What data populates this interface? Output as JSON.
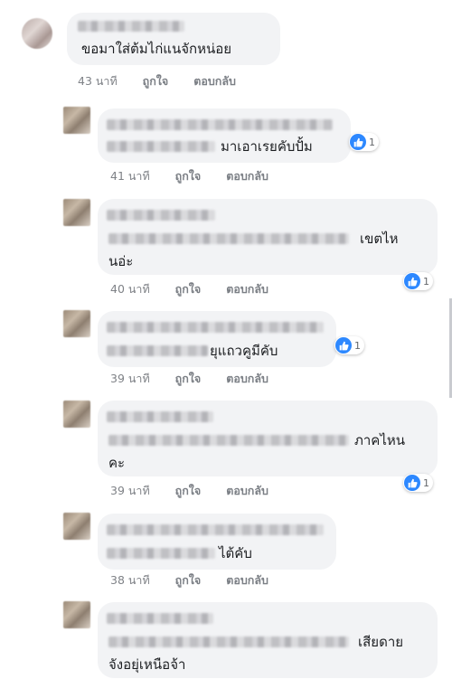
{
  "comments": [
    {
      "text": "ขอมาใส่ต้มไก่แนจักหน่อย",
      "time": "43 นาที",
      "like": "ถูกใจ",
      "reply": "ตอบกลับ"
    },
    {
      "text": "มาเอาเรยคับปั้ม",
      "time": "41 นาที",
      "like": "ถูกใจ",
      "reply": "ตอบกลับ",
      "reactions": "1"
    },
    {
      "text": "เขตไห",
      "text2": "นอ่ะ",
      "time": "40 นาที",
      "like": "ถูกใจ",
      "reply": "ตอบกลับ",
      "reactions": "1"
    },
    {
      "text": "ยุแถวคูมีคับ",
      "time": "39 นาที",
      "like": "ถูกใจ",
      "reply": "ตอบกลับ",
      "reactions": "1"
    },
    {
      "text": "ภาคไหน",
      "text2": "คะ",
      "time": "39 นาที",
      "like": "ถูกใจ",
      "reply": "ตอบกลับ",
      "reactions": "1"
    },
    {
      "text": "ไต้คับ",
      "time": "38 นาที",
      "like": "ถูกใจ",
      "reply": "ตอบกลับ"
    },
    {
      "text": "เสียดาย",
      "text2": "จังอยุ่เหนือจ้า"
    }
  ],
  "colors": {
    "bubble": "#f2f3f5",
    "like": "#2d88ff",
    "meta": "#7f8287"
  },
  "icons": {
    "reaction": "like-thumb-icon"
  }
}
